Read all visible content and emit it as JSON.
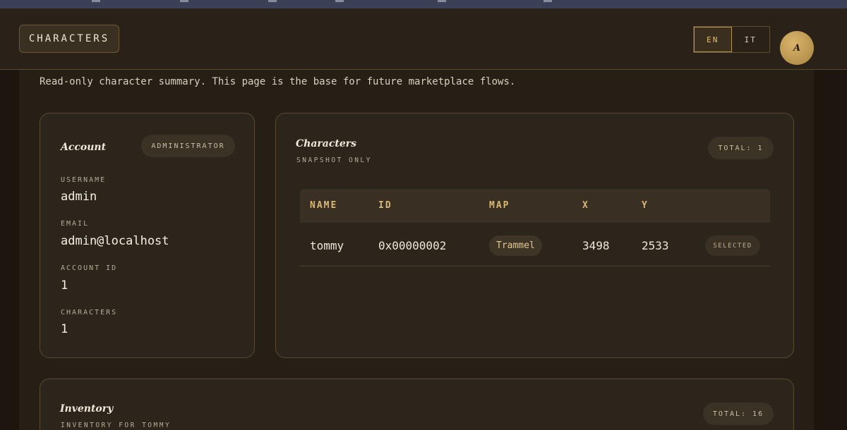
{
  "header": {
    "brand": "CHARACTERS",
    "languages": [
      "EN",
      "IT"
    ],
    "active_language": "EN",
    "avatar_initial": "A"
  },
  "subtitle": "Read-only character summary. This page is the base for future marketplace flows.",
  "account": {
    "title": "Account",
    "role_badge": "ADMINISTRATOR",
    "fields": [
      {
        "label": "USERNAME",
        "value": "admin"
      },
      {
        "label": "EMAIL",
        "value": "admin@localhost"
      },
      {
        "label": "ACCOUNT ID",
        "value": "1"
      },
      {
        "label": "CHARACTERS",
        "value": "1"
      }
    ]
  },
  "characters": {
    "title": "Characters",
    "kicker": "SNAPSHOT ONLY",
    "total": "TOTAL: 1",
    "columns": [
      "NAME",
      "ID",
      "MAP",
      "X",
      "Y"
    ],
    "rows": [
      {
        "name": "tommy",
        "id": "0x00000002",
        "map": "Trammel",
        "x": "3498",
        "y": "2533",
        "status": "SELECTED"
      }
    ]
  },
  "inventory": {
    "title": "Inventory",
    "kicker": "INVENTORY FOR TOMMY",
    "total": "TOTAL: 16"
  },
  "colors": {
    "background": "#1c160f",
    "card": "#2c251b",
    "accent_gold": "#d8b874",
    "border": "#5a4a30"
  }
}
